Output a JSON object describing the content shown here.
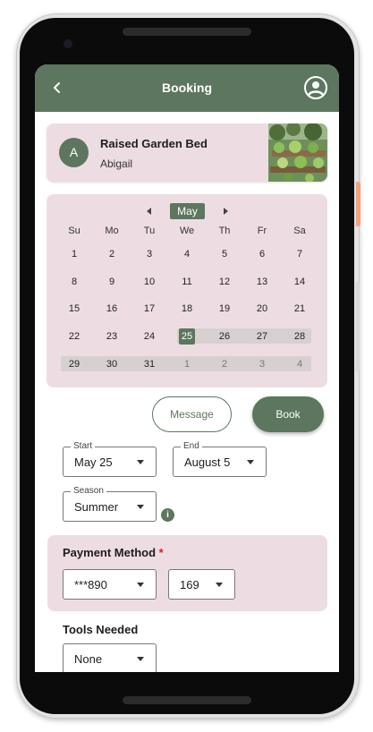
{
  "appbar": {
    "title": "Booking"
  },
  "listing": {
    "avatar_initial": "A",
    "title": "Raised Garden Bed",
    "owner": "Abigail"
  },
  "calendar": {
    "month": "May",
    "weekdays": [
      "Su",
      "Mo",
      "Tu",
      "We",
      "Th",
      "Fr",
      "Sa"
    ],
    "weeks": [
      [
        "1",
        "2",
        "3",
        "4",
        "5",
        "6",
        "7"
      ],
      [
        "8",
        "9",
        "10",
        "11",
        "12",
        "13",
        "14"
      ],
      [
        "15",
        "16",
        "17",
        "18",
        "19",
        "20",
        "21"
      ],
      [
        "22",
        "23",
        "24",
        "25",
        "26",
        "27",
        "28"
      ],
      [
        "29",
        "30",
        "31",
        "1",
        "2",
        "3",
        "4"
      ]
    ],
    "selected_day": "25"
  },
  "actions": {
    "message_label": "Message",
    "book_label": "Book"
  },
  "dates": {
    "start_label": "Start",
    "start_value": "May 25",
    "end_label": "End",
    "end_value": "August 5"
  },
  "season": {
    "label": "Season",
    "value": "Summer",
    "info_icon": "info-icon"
  },
  "payment": {
    "label": "Payment Method",
    "required_mark": "*",
    "card_value": "***890",
    "cvv_value": "169"
  },
  "tools": {
    "label": "Tools Needed",
    "value": "None"
  },
  "colors": {
    "primary": "#5d765f",
    "card_bg": "#eddde2",
    "range": "#d6d1d0",
    "required": "#c62828"
  }
}
